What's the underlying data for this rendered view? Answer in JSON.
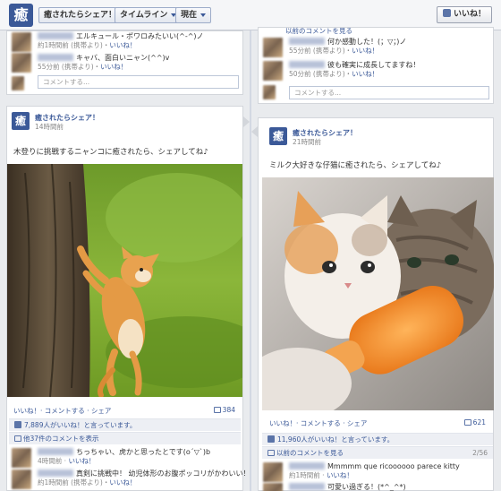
{
  "topbar": {
    "logo_char": "癒",
    "page_button": "癒されたらシェア！",
    "timeline_button": "タイムライン",
    "now_button": "現在",
    "like_button": "いいね！"
  },
  "left": {
    "top_comments": [
      {
        "text": "エルキュール・ポワロみたいい(^-^)ノ",
        "meta_time": "約1時間前 (携帯より)・",
        "meta_like": "いいね！"
      },
      {
        "text": "キャバ、面白いニャン(^^)v",
        "meta_time": "55分前 (携帯より)・",
        "meta_like": "いいね！"
      }
    ],
    "comment_placeholder": "コメントする...",
    "post": {
      "page_name": "癒されたらシェア！",
      "time": "14時間前",
      "text": "木登りに挑戦するニャンコに癒されたら、シェアしてね♪",
      "actions": "いいね！· コメントする · シェア",
      "comment_count": "384",
      "likes_text": "7,889人がいいね！と言っています。",
      "more_comments": "他37件のコメントを表示",
      "comments": [
        {
          "text": "ちっちゃい、虎かと思ったとです(o´▽`)b",
          "meta_time": "4時間前 · ",
          "meta_like": "いいね！"
        },
        {
          "text": "真剣に挑戦中！ 幼児体形のお腹ポッコリがかわいい！",
          "meta_time": "約1時間前 (携帯より)・",
          "meta_like": "いいね！"
        }
      ]
    }
  },
  "right": {
    "top_header": "以前のコメントを見る",
    "top_comments": [
      {
        "text": "何か感動した！(；▽；)ノ",
        "meta_time": "55分前 (携帯より)・",
        "meta_like": "いいね！"
      },
      {
        "text": "彼も確実に成長してますね！",
        "meta_time": "50分前 (携帯より)・",
        "meta_like": "いいね！"
      }
    ],
    "comment_placeholder": "コメントする...",
    "post": {
      "page_name": "癒されたらシェア！",
      "time": "21時間前",
      "text": "ミルク大好きな仔猫に癒されたら、シェアしてね♪",
      "actions": "いいね！· コメントする · シェア",
      "comment_count": "621",
      "likes_text": "11,960人がいいね！と言っています。",
      "more_comments": "以前のコメントを見る",
      "pager": "2/56",
      "comments": [
        {
          "text": "Mmmmm que ricoooooo parece kitty",
          "meta_time": "約1時間前 · ",
          "meta_like": "いいね！"
        },
        {
          "text": "可愛い過ぎる！(*^_^*)",
          "meta_time": "",
          "meta_like": ""
        }
      ]
    }
  }
}
